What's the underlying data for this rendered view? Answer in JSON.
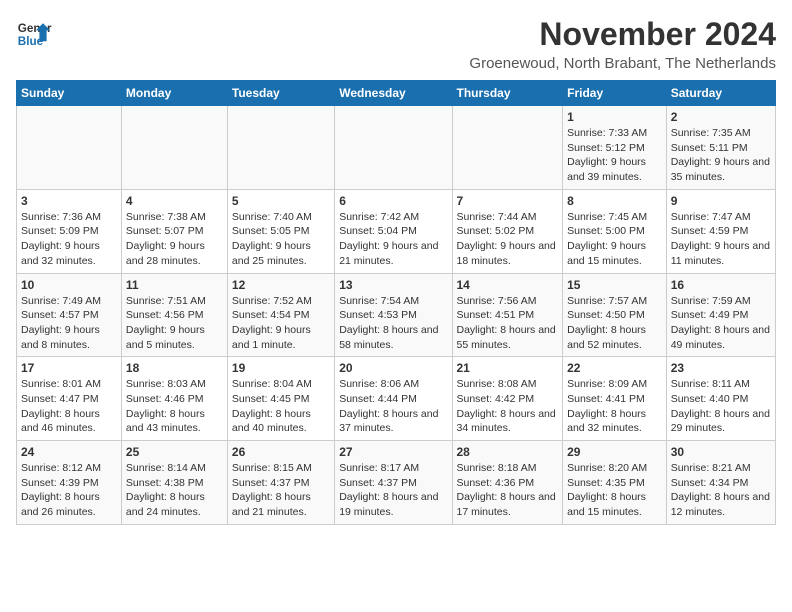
{
  "logo": {
    "line1": "General",
    "line2": "Blue"
  },
  "title": "November 2024",
  "subtitle": "Groenewoud, North Brabant, The Netherlands",
  "days_of_week": [
    "Sunday",
    "Monday",
    "Tuesday",
    "Wednesday",
    "Thursday",
    "Friday",
    "Saturday"
  ],
  "weeks": [
    [
      {
        "day": "",
        "info": ""
      },
      {
        "day": "",
        "info": ""
      },
      {
        "day": "",
        "info": ""
      },
      {
        "day": "",
        "info": ""
      },
      {
        "day": "",
        "info": ""
      },
      {
        "day": "1",
        "info": "Sunrise: 7:33 AM\nSunset: 5:12 PM\nDaylight: 9 hours and 39 minutes."
      },
      {
        "day": "2",
        "info": "Sunrise: 7:35 AM\nSunset: 5:11 PM\nDaylight: 9 hours and 35 minutes."
      }
    ],
    [
      {
        "day": "3",
        "info": "Sunrise: 7:36 AM\nSunset: 5:09 PM\nDaylight: 9 hours and 32 minutes."
      },
      {
        "day": "4",
        "info": "Sunrise: 7:38 AM\nSunset: 5:07 PM\nDaylight: 9 hours and 28 minutes."
      },
      {
        "day": "5",
        "info": "Sunrise: 7:40 AM\nSunset: 5:05 PM\nDaylight: 9 hours and 25 minutes."
      },
      {
        "day": "6",
        "info": "Sunrise: 7:42 AM\nSunset: 5:04 PM\nDaylight: 9 hours and 21 minutes."
      },
      {
        "day": "7",
        "info": "Sunrise: 7:44 AM\nSunset: 5:02 PM\nDaylight: 9 hours and 18 minutes."
      },
      {
        "day": "8",
        "info": "Sunrise: 7:45 AM\nSunset: 5:00 PM\nDaylight: 9 hours and 15 minutes."
      },
      {
        "day": "9",
        "info": "Sunrise: 7:47 AM\nSunset: 4:59 PM\nDaylight: 9 hours and 11 minutes."
      }
    ],
    [
      {
        "day": "10",
        "info": "Sunrise: 7:49 AM\nSunset: 4:57 PM\nDaylight: 9 hours and 8 minutes."
      },
      {
        "day": "11",
        "info": "Sunrise: 7:51 AM\nSunset: 4:56 PM\nDaylight: 9 hours and 5 minutes."
      },
      {
        "day": "12",
        "info": "Sunrise: 7:52 AM\nSunset: 4:54 PM\nDaylight: 9 hours and 1 minute."
      },
      {
        "day": "13",
        "info": "Sunrise: 7:54 AM\nSunset: 4:53 PM\nDaylight: 8 hours and 58 minutes."
      },
      {
        "day": "14",
        "info": "Sunrise: 7:56 AM\nSunset: 4:51 PM\nDaylight: 8 hours and 55 minutes."
      },
      {
        "day": "15",
        "info": "Sunrise: 7:57 AM\nSunset: 4:50 PM\nDaylight: 8 hours and 52 minutes."
      },
      {
        "day": "16",
        "info": "Sunrise: 7:59 AM\nSunset: 4:49 PM\nDaylight: 8 hours and 49 minutes."
      }
    ],
    [
      {
        "day": "17",
        "info": "Sunrise: 8:01 AM\nSunset: 4:47 PM\nDaylight: 8 hours and 46 minutes."
      },
      {
        "day": "18",
        "info": "Sunrise: 8:03 AM\nSunset: 4:46 PM\nDaylight: 8 hours and 43 minutes."
      },
      {
        "day": "19",
        "info": "Sunrise: 8:04 AM\nSunset: 4:45 PM\nDaylight: 8 hours and 40 minutes."
      },
      {
        "day": "20",
        "info": "Sunrise: 8:06 AM\nSunset: 4:44 PM\nDaylight: 8 hours and 37 minutes."
      },
      {
        "day": "21",
        "info": "Sunrise: 8:08 AM\nSunset: 4:42 PM\nDaylight: 8 hours and 34 minutes."
      },
      {
        "day": "22",
        "info": "Sunrise: 8:09 AM\nSunset: 4:41 PM\nDaylight: 8 hours and 32 minutes."
      },
      {
        "day": "23",
        "info": "Sunrise: 8:11 AM\nSunset: 4:40 PM\nDaylight: 8 hours and 29 minutes."
      }
    ],
    [
      {
        "day": "24",
        "info": "Sunrise: 8:12 AM\nSunset: 4:39 PM\nDaylight: 8 hours and 26 minutes."
      },
      {
        "day": "25",
        "info": "Sunrise: 8:14 AM\nSunset: 4:38 PM\nDaylight: 8 hours and 24 minutes."
      },
      {
        "day": "26",
        "info": "Sunrise: 8:15 AM\nSunset: 4:37 PM\nDaylight: 8 hours and 21 minutes."
      },
      {
        "day": "27",
        "info": "Sunrise: 8:17 AM\nSunset: 4:37 PM\nDaylight: 8 hours and 19 minutes."
      },
      {
        "day": "28",
        "info": "Sunrise: 8:18 AM\nSunset: 4:36 PM\nDaylight: 8 hours and 17 minutes."
      },
      {
        "day": "29",
        "info": "Sunrise: 8:20 AM\nSunset: 4:35 PM\nDaylight: 8 hours and 15 minutes."
      },
      {
        "day": "30",
        "info": "Sunrise: 8:21 AM\nSunset: 4:34 PM\nDaylight: 8 hours and 12 minutes."
      }
    ]
  ]
}
